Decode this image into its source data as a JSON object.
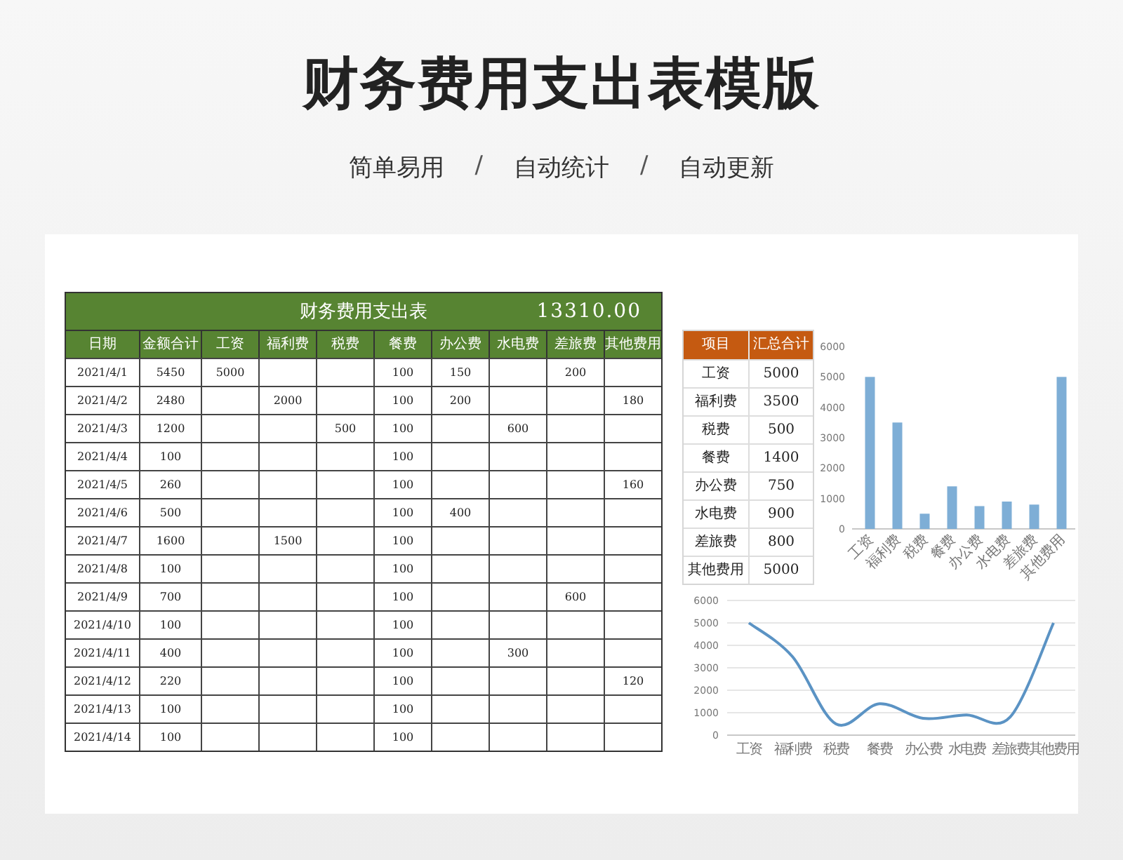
{
  "title": "财务费用支出表模版",
  "subtitle": {
    "features": [
      "简单易用",
      "自动统计",
      "自动更新"
    ],
    "separators": [
      "/",
      "/"
    ]
  },
  "expense_table": {
    "title": "财务费用支出表",
    "total": "13310.00",
    "columns": [
      "日期",
      "金额合计",
      "工资",
      "福利费",
      "税费",
      "餐费",
      "办公费",
      "水电费",
      "差旅费",
      "其他费用"
    ],
    "rows": [
      [
        "2021/4/1",
        "5450",
        "5000",
        null,
        null,
        "100",
        "150",
        null,
        "200",
        null
      ],
      [
        "2021/4/2",
        "2480",
        null,
        "2000",
        null,
        "100",
        "200",
        null,
        null,
        "180"
      ],
      [
        "2021/4/3",
        "1200",
        null,
        null,
        "500",
        "100",
        null,
        "600",
        null,
        null
      ],
      [
        "2021/4/4",
        "100",
        null,
        null,
        null,
        "100",
        null,
        null,
        null,
        null
      ],
      [
        "2021/4/5",
        "260",
        null,
        null,
        null,
        "100",
        null,
        null,
        null,
        "160"
      ],
      [
        "2021/4/6",
        "500",
        null,
        null,
        null,
        "100",
        "400",
        null,
        null,
        null
      ],
      [
        "2021/4/7",
        "1600",
        null,
        "1500",
        null,
        "100",
        null,
        null,
        null,
        null
      ],
      [
        "2021/4/8",
        "100",
        null,
        null,
        null,
        "100",
        null,
        null,
        null,
        null
      ],
      [
        "2021/4/9",
        "700",
        null,
        null,
        null,
        "100",
        null,
        null,
        "600",
        null
      ],
      [
        "2021/4/10",
        "100",
        null,
        null,
        null,
        "100",
        null,
        null,
        null,
        null
      ],
      [
        "2021/4/11",
        "400",
        null,
        null,
        null,
        "100",
        null,
        "300",
        null,
        null
      ],
      [
        "2021/4/12",
        "220",
        null,
        null,
        null,
        "100",
        null,
        null,
        null,
        "120"
      ],
      [
        "2021/4/13",
        "100",
        null,
        null,
        null,
        "100",
        null,
        null,
        null,
        null
      ],
      [
        "2021/4/14",
        "100",
        null,
        null,
        null,
        "100",
        null,
        null,
        null,
        null
      ]
    ]
  },
  "summary_table": {
    "columns": [
      "项目",
      "汇总合计"
    ],
    "rows": [
      {
        "item": "工资",
        "total": "5000"
      },
      {
        "item": "福利费",
        "total": "3500"
      },
      {
        "item": "税费",
        "total": "500"
      },
      {
        "item": "餐费",
        "total": "1400"
      },
      {
        "item": "办公费",
        "total": "750"
      },
      {
        "item": "水电费",
        "total": "900"
      },
      {
        "item": "差旅费",
        "total": "800"
      },
      {
        "item": "其他费用",
        "total": "5000"
      }
    ]
  },
  "bar_chart": {
    "chart_data": {
      "type": "bar",
      "categories": [
        "工资",
        "福利费",
        "税费",
        "餐费",
        "办公费",
        "水电费",
        "差旅费",
        "其他费用"
      ],
      "series": [
        {
          "color": "#7eaed6",
          "values": [
            5000,
            3500,
            500,
            1400,
            750,
            900,
            800,
            5000
          ]
        }
      ],
      "ylim": [
        0,
        6000
      ],
      "yticks": [
        0,
        1000,
        2000,
        3000,
        4000,
        5000,
        6000
      ]
    }
  },
  "line_chart": {
    "chart_data": {
      "type": "line",
      "categories": [
        "工资",
        "福利费",
        "税费",
        "餐费",
        "办公费",
        "水电费",
        "差旅费",
        "其他费用"
      ],
      "series": [
        {
          "color": "#5b93c4",
          "values": [
            5000,
            3500,
            500,
            1400,
            750,
            900,
            800,
            5000
          ]
        }
      ],
      "ylim": [
        0,
        6000
      ],
      "yticks": [
        0,
        1000,
        2000,
        3000,
        4000,
        5000,
        6000
      ],
      "grid": true
    }
  }
}
